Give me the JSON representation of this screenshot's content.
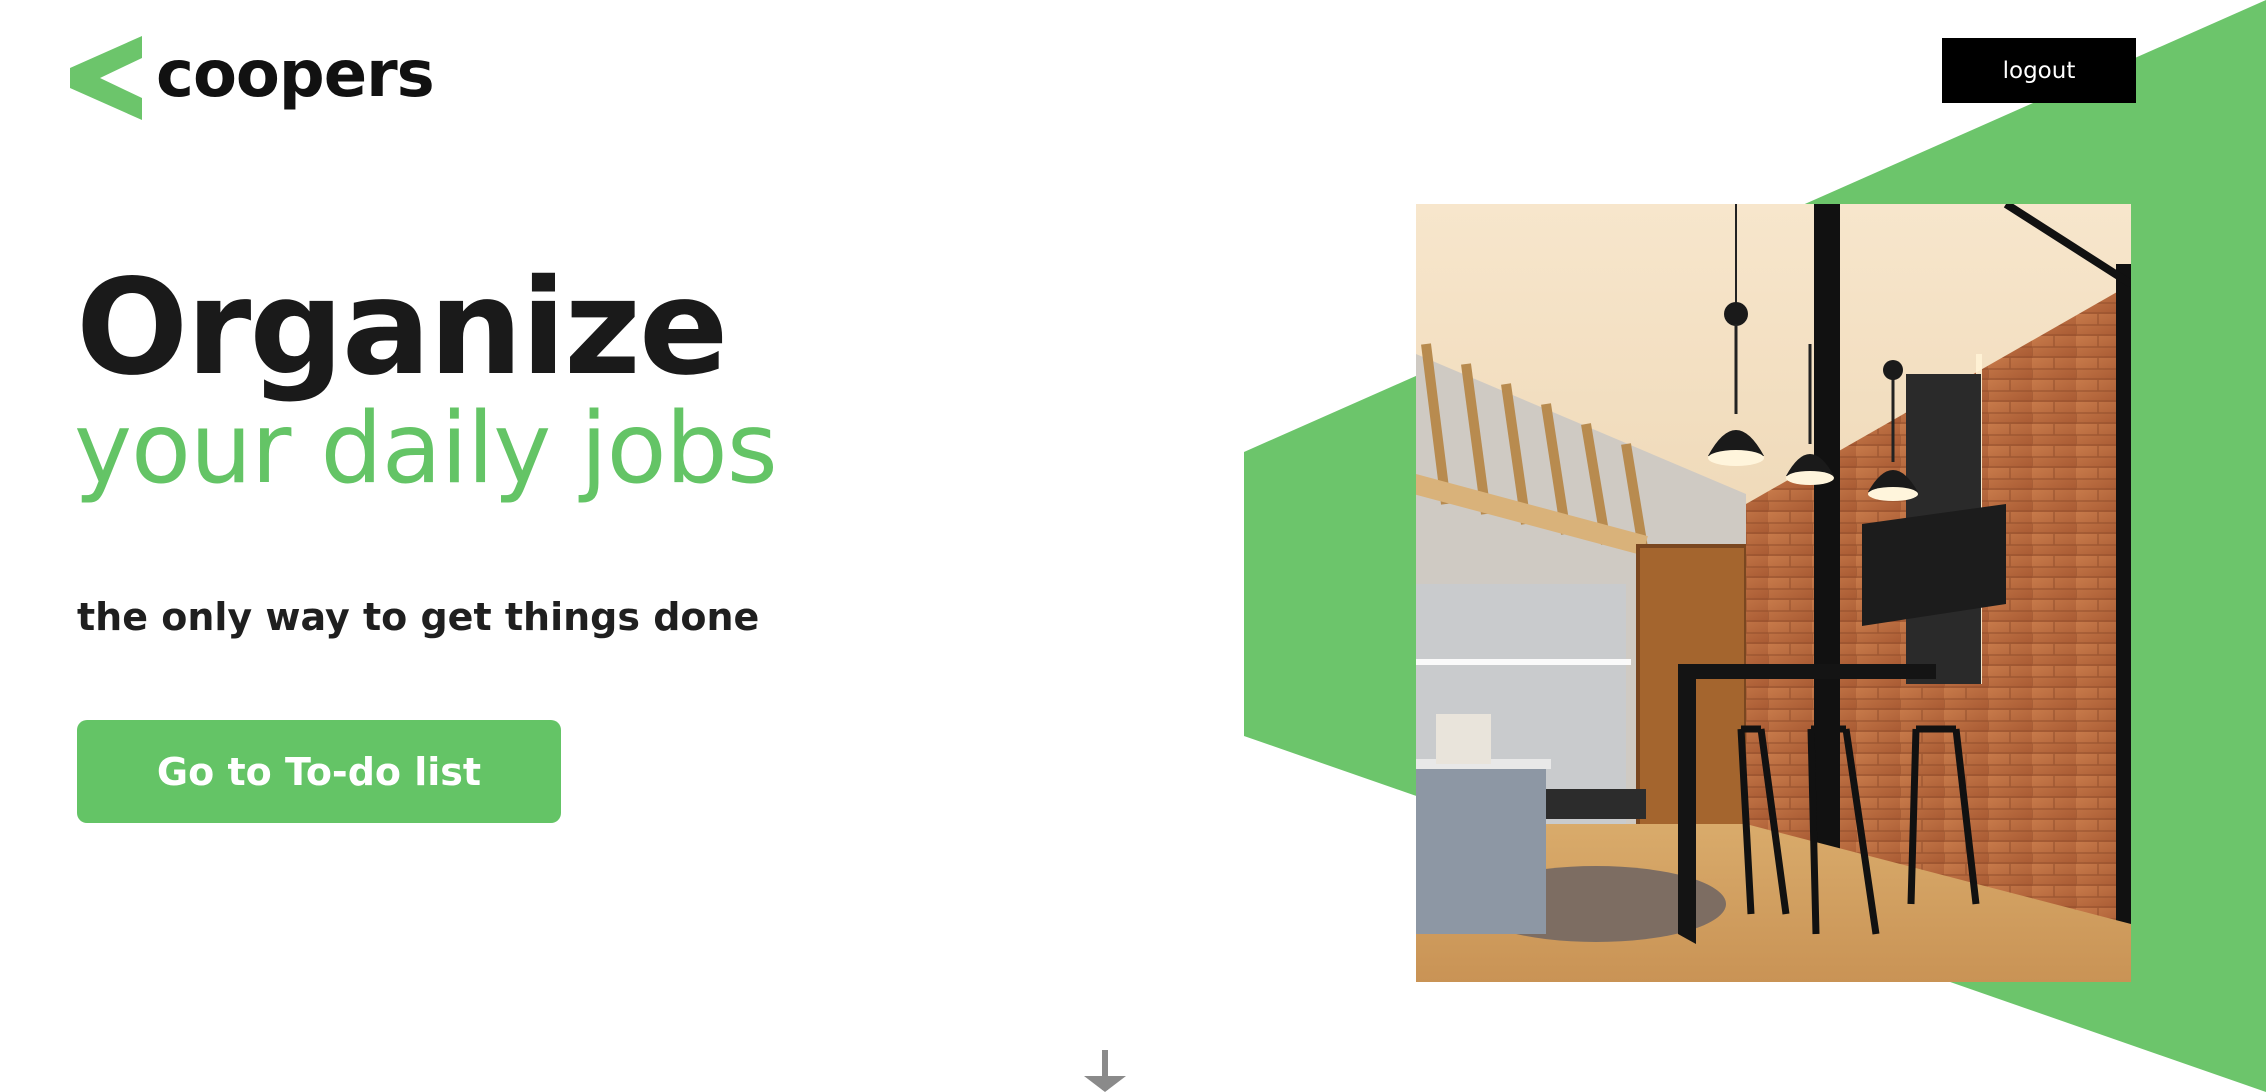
{
  "header": {
    "brand_name": "coopers",
    "logo_icon": "chevron-left-logo-icon",
    "logout_label": "logout"
  },
  "hero": {
    "title": "Organize",
    "subtitle": "your daily jobs",
    "tagline": "the only way to get things done",
    "cta_label": "Go to To-do list"
  },
  "scroll": {
    "icon": "arrow-down-icon"
  },
  "colors": {
    "brand_green": "#64c466",
    "text_dark": "#1a1a1a",
    "logout_bg": "#000000"
  }
}
